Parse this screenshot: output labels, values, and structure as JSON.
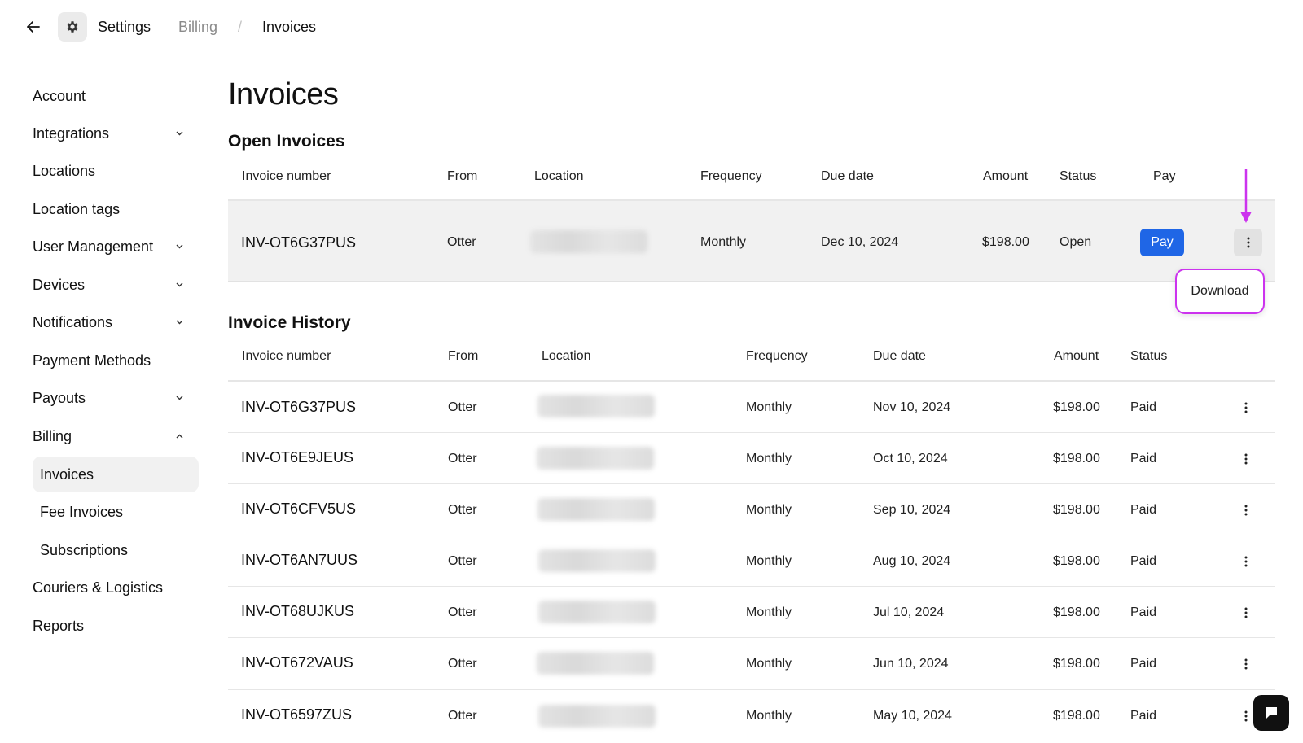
{
  "breadcrumb": {
    "settings": "Settings",
    "billing": "Billing",
    "separator": "/",
    "invoices": "Invoices"
  },
  "sidebar": {
    "items": [
      {
        "label": "Account",
        "has_chevron": false
      },
      {
        "label": "Integrations",
        "has_chevron": "down"
      },
      {
        "label": "Locations",
        "has_chevron": false
      },
      {
        "label": "Location tags",
        "has_chevron": false
      },
      {
        "label": "User Management",
        "has_chevron": "down"
      },
      {
        "label": "Devices",
        "has_chevron": "down"
      },
      {
        "label": "Notifications",
        "has_chevron": "down"
      },
      {
        "label": "Payment Methods",
        "has_chevron": false
      },
      {
        "label": "Payouts",
        "has_chevron": "down"
      },
      {
        "label": "Billing",
        "has_chevron": "up"
      }
    ],
    "billing_sub": [
      {
        "label": "Invoices",
        "active": true
      },
      {
        "label": "Fee Invoices",
        "active": false
      },
      {
        "label": "Subscriptions",
        "active": false
      }
    ],
    "bottom_items": [
      {
        "label": "Couriers & Logistics"
      },
      {
        "label": "Reports"
      }
    ]
  },
  "main": {
    "title": "Invoices",
    "open_section_title": "Open Invoices",
    "history_section_title": "Invoice History",
    "open_headers": {
      "invoice_number": "Invoice number",
      "from": "From",
      "location": "Location",
      "frequency": "Frequency",
      "due_date": "Due date",
      "amount": "Amount",
      "status": "Status",
      "pay": "Pay"
    },
    "history_headers": {
      "invoice_number": "Invoice number",
      "from": "From",
      "location": "Location",
      "frequency": "Frequency",
      "due_date": "Due date",
      "amount": "Amount",
      "status": "Status"
    },
    "open_invoice": {
      "number": "INV-OT6G37PUS",
      "from": "Otter",
      "frequency": "Monthly",
      "due_date": "Dec 10, 2024",
      "amount": "$198.00",
      "status": "Open",
      "pay_label": "Pay"
    },
    "download_label": "Download",
    "history": [
      {
        "number": "INV-OT6G37PUS",
        "from": "Otter",
        "frequency": "Monthly",
        "due_date": "Nov 10, 2024",
        "amount": "$198.00",
        "status": "Paid"
      },
      {
        "number": "INV-OT6E9JEUS",
        "from": "Otter",
        "frequency": "Monthly",
        "due_date": "Oct 10, 2024",
        "amount": "$198.00",
        "status": "Paid"
      },
      {
        "number": "INV-OT6CFV5US",
        "from": "Otter",
        "frequency": "Monthly",
        "due_date": "Sep 10, 2024",
        "amount": "$198.00",
        "status": "Paid"
      },
      {
        "number": "INV-OT6AN7UUS",
        "from": "Otter",
        "frequency": "Monthly",
        "due_date": "Aug 10, 2024",
        "amount": "$198.00",
        "status": "Paid"
      },
      {
        "number": "INV-OT68UJKUS",
        "from": "Otter",
        "frequency": "Monthly",
        "due_date": "Jul 10, 2024",
        "amount": "$198.00",
        "status": "Paid"
      },
      {
        "number": "INV-OT672VAUS",
        "from": "Otter",
        "frequency": "Monthly",
        "due_date": "Jun 10, 2024",
        "amount": "$198.00",
        "status": "Paid"
      },
      {
        "number": "INV-OT6597ZUS",
        "from": "Otter",
        "frequency": "Monthly",
        "due_date": "May 10, 2024",
        "amount": "$198.00",
        "status": "Paid"
      }
    ]
  },
  "colors": {
    "accent": "#1f66e6",
    "annotation": "#cc33ee"
  },
  "icons": {
    "back": "arrow-left-icon",
    "settings": "gear-icon",
    "row_menu": "kebab-menu-icon",
    "chat": "chat-icon"
  }
}
